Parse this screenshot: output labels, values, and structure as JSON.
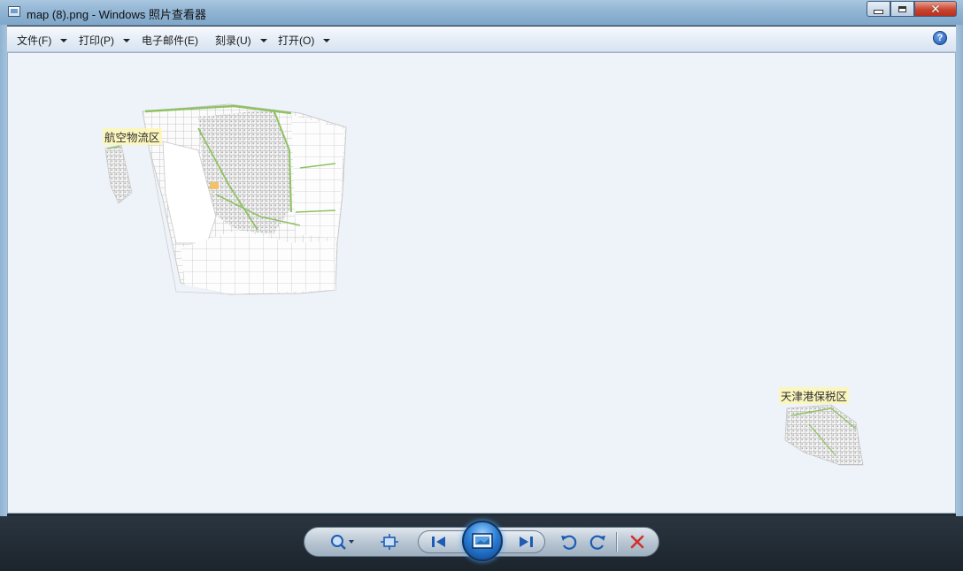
{
  "window": {
    "title": "map (8).png - Windows 照片查看器",
    "controls": {
      "minimize": "minimize",
      "maximize": "maximize",
      "close": "close"
    }
  },
  "menu": {
    "items": [
      {
        "label": "文件(F)",
        "has_arrow": true
      },
      {
        "label": "打印(P)",
        "has_arrow": true
      },
      {
        "label": "电子邮件(E)",
        "has_arrow": false
      },
      {
        "label": "刻录(U)",
        "has_arrow": true
      },
      {
        "label": "打开(O)",
        "has_arrow": true
      }
    ],
    "help_icon": "help-icon"
  },
  "image": {
    "labels": {
      "airport": "航空物流区",
      "port": "天津港保税区"
    },
    "colors": {
      "background": "#eef3f9",
      "roads": "#b8b8b8",
      "green": "#8fc163",
      "label_bg": "#fff7aa"
    }
  },
  "toolbar": {
    "buttons": [
      {
        "name": "zoom",
        "icon": "magnifier-icon"
      },
      {
        "name": "actual-size",
        "icon": "fit-window-icon"
      },
      {
        "name": "previous",
        "icon": "previous-icon"
      },
      {
        "name": "slideshow",
        "icon": "slideshow-icon"
      },
      {
        "name": "next",
        "icon": "next-icon"
      },
      {
        "name": "rotate-counterclockwise",
        "icon": "rotate-left-icon"
      },
      {
        "name": "rotate-clockwise",
        "icon": "rotate-right-icon"
      },
      {
        "name": "delete",
        "icon": "delete-icon"
      }
    ],
    "accent": "#2a7fd6",
    "delete_color": "#d0312d"
  }
}
